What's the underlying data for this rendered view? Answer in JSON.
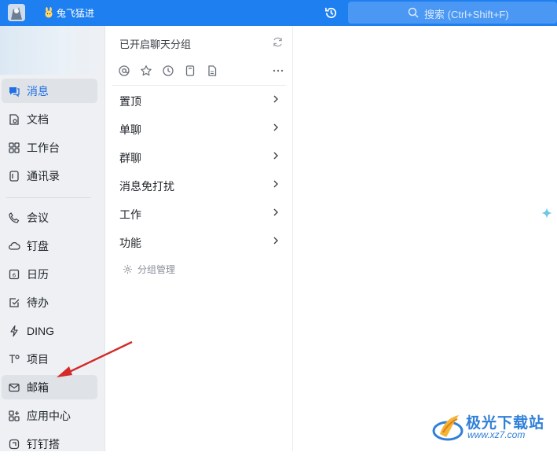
{
  "topbar": {
    "org_name": "兔飞猛进",
    "search_placeholder": "搜索 (Ctrl+Shift+F)"
  },
  "sidebar": {
    "items": [
      {
        "label": "消息",
        "icon": "message-icon",
        "active": true
      },
      {
        "label": "文档",
        "icon": "document-icon"
      },
      {
        "label": "工作台",
        "icon": "workbench-icon"
      },
      {
        "label": "通讯录",
        "icon": "contacts-icon"
      },
      {
        "label": "会议",
        "icon": "meeting-icon"
      },
      {
        "label": "钉盘",
        "icon": "cloud-drive-icon"
      },
      {
        "label": "日历",
        "icon": "calendar-icon"
      },
      {
        "label": "待办",
        "icon": "todo-icon"
      },
      {
        "label": "DING",
        "icon": "ding-icon"
      },
      {
        "label": "项目",
        "icon": "project-icon"
      },
      {
        "label": "邮箱",
        "icon": "mail-icon",
        "highlighted": true
      },
      {
        "label": "应用中心",
        "icon": "app-center-icon"
      },
      {
        "label": "钉钉搭",
        "icon": "dingda-icon"
      }
    ]
  },
  "panel": {
    "title": "已开启聊天分组",
    "groups": [
      {
        "label": "置顶"
      },
      {
        "label": "单聊"
      },
      {
        "label": "群聊"
      },
      {
        "label": "消息免打扰"
      },
      {
        "label": "工作"
      },
      {
        "label": "功能"
      }
    ],
    "manage_label": "分组管理"
  },
  "watermark": {
    "name": "极光下载站",
    "url": "www.xz7.com"
  },
  "colors": {
    "accent": "#1e7ff0",
    "annotation_arrow": "#d42a2a"
  }
}
